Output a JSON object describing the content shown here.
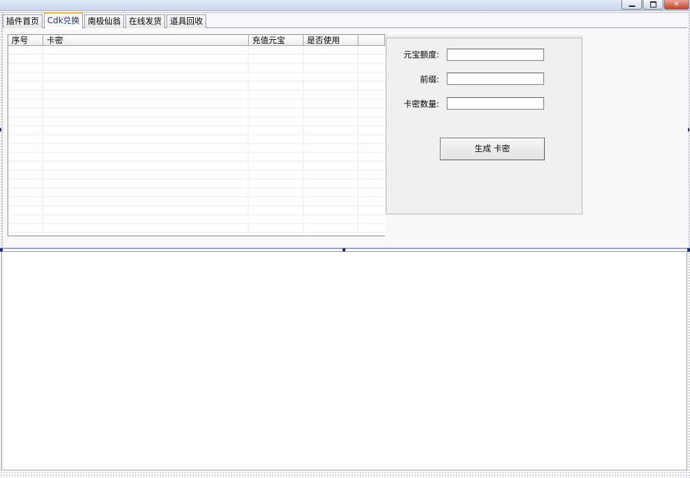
{
  "window": {
    "minimize_glyph": "",
    "maximize_glyph": "",
    "close_glyph": "✕"
  },
  "tabs": [
    {
      "label": "插件首页",
      "active": false
    },
    {
      "label": "Cdk兑换",
      "active": true
    },
    {
      "label": "南极仙翁",
      "active": false
    },
    {
      "label": "在线发货",
      "active": false
    },
    {
      "label": "道具回收",
      "active": false
    }
  ],
  "grid": {
    "columns": [
      "序号",
      "卡密",
      "充值元宝",
      "是否使用",
      ""
    ],
    "rows": []
  },
  "form": {
    "amount_label": "元宝额度:",
    "amount_value": "",
    "prefix_label": "前缀:",
    "prefix_value": "",
    "count_label": "卡密数量:",
    "count_value": "",
    "generate_button": "生成 卡密"
  },
  "log": {
    "content": ""
  }
}
